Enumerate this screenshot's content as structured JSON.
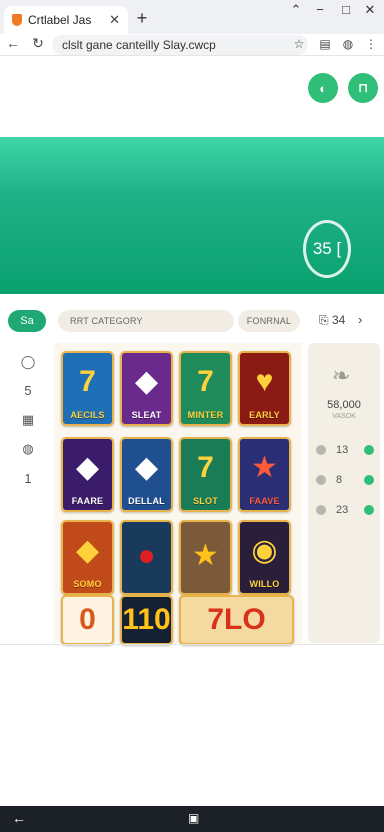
{
  "browser": {
    "tab_title": "Crtlabel Jas",
    "tab_close": "✕",
    "new_tab": "+",
    "window_controls": [
      "⌃",
      "−",
      "□",
      "✕"
    ],
    "url": "clslt gane canteilly Slay.cwcp"
  },
  "header": {
    "buttons": [
      "◐",
      "⊓"
    ]
  },
  "banner": {
    "timer": "35 ["
  },
  "categories": {
    "active_label": "Sa",
    "search_placeholder": "RRT CATEGORY",
    "filter_label": "FONRNAL",
    "count": "34",
    "chevron": "›"
  },
  "rail": [
    "◯",
    "5",
    "▦",
    "◍",
    "1"
  ],
  "tiles": [
    {
      "art": "7",
      "label": "AECILS",
      "bg": "#1e6fb6",
      "fg": "#ffd23b"
    },
    {
      "art": "◆",
      "label": "SLEAT",
      "bg": "#6a2a8c",
      "fg": "#ffffff"
    },
    {
      "art": "7",
      "label": "MINTER",
      "bg": "#1f8a5a",
      "fg": "#ffd23b"
    },
    {
      "art": "♥",
      "label": "EARLY",
      "bg": "#8a1b14",
      "fg": "#ffd23b"
    },
    {
      "art": "◆",
      "label": "FAARE",
      "bg": "#3b1c6a",
      "fg": "#ffffff"
    },
    {
      "art": "◆",
      "label": "DELLAL",
      "bg": "#1f4f8f",
      "fg": "#ffffff"
    },
    {
      "art": "7",
      "label": "SLOT",
      "bg": "#197c57",
      "fg": "#ffd23b"
    },
    {
      "art": "★",
      "label": "FAAVE",
      "bg": "#2a2f75",
      "fg": "#ff5a3a"
    },
    {
      "art": "◆",
      "label": "SOMO",
      "bg": "#c04a1a",
      "fg": "#ffd23b"
    },
    {
      "art": "●",
      "label": "",
      "bg": "#1a3a5c",
      "fg": "#e02020"
    },
    {
      "art": "★",
      "label": "",
      "bg": "#7a5a3a",
      "fg": "#ffc21a"
    },
    {
      "art": "◉",
      "label": "WILLO",
      "bg": "#2a1f3a",
      "fg": "#ffd23b"
    },
    {
      "art": "0",
      "label": "",
      "bg": "#fff4e4",
      "fg": "#d85a1a"
    },
    {
      "art": "110",
      "label": "",
      "bg": "#152033",
      "fg": "#ffc21a"
    },
    {
      "art": "7LO",
      "label": "",
      "bg": "#f4d9a0",
      "fg": "#d8321a"
    },
    {
      "art": "",
      "label": "",
      "bg": "#f4d9a0",
      "fg": "#d8321a"
    }
  ],
  "side_panel": {
    "icon": "❧",
    "count": "58,000",
    "sub": "VASOK",
    "stats": [
      "13",
      "8",
      "23"
    ]
  },
  "system_bar": {
    "back": "←",
    "home": "▣"
  }
}
